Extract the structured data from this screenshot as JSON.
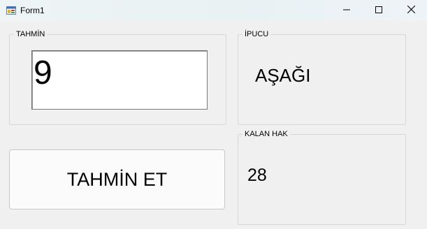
{
  "window": {
    "title": "Form1",
    "icons": {
      "app": "form-app-icon",
      "minimize": "minimize-icon",
      "maximize": "maximize-icon",
      "close": "close-icon"
    }
  },
  "guess_group": {
    "label": "TAHMİN",
    "input_value": "9"
  },
  "hint_group": {
    "label": "İPUCU",
    "hint_text": "AŞAĞI"
  },
  "remaining_group": {
    "label": "KALAN HAK",
    "value": "28"
  },
  "guess_button": {
    "label": "TAHMİN ET"
  }
}
